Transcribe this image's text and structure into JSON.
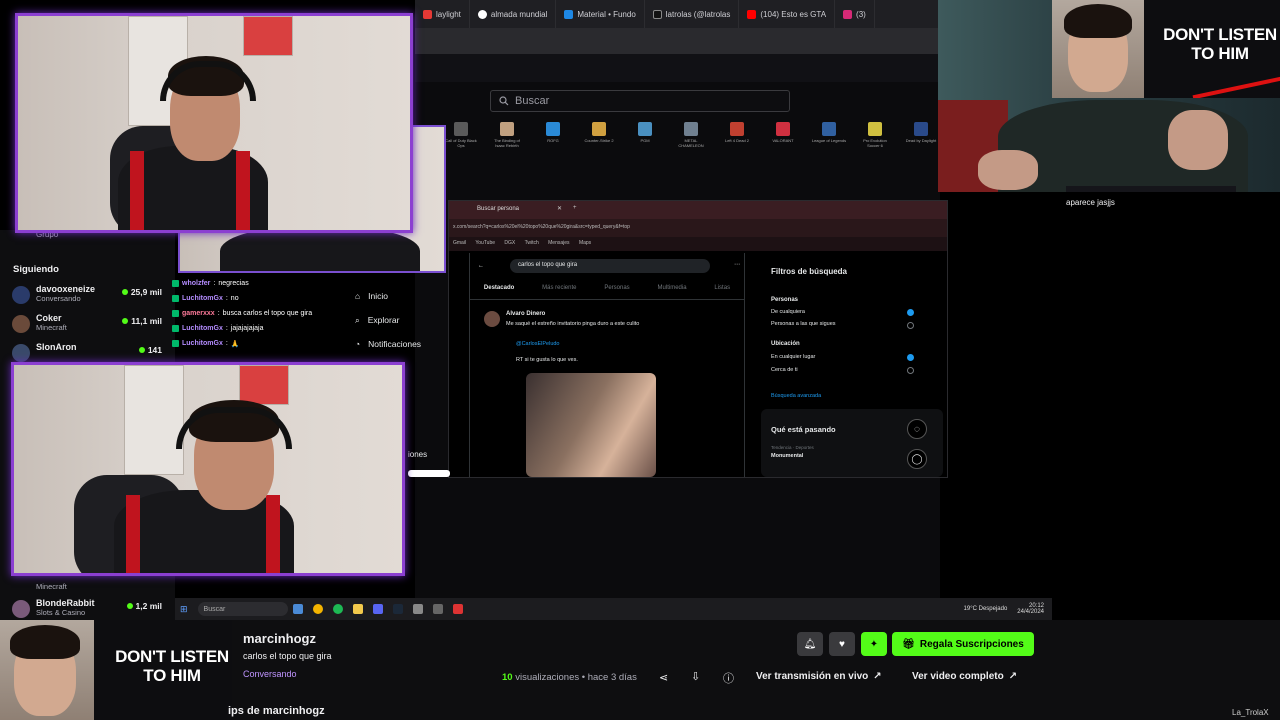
{
  "browser": {
    "tabs": [
      "laylight",
      "almada mundial",
      "Material • Fundo",
      "latrolas (@latrolas",
      "(104) Esto es GTA",
      "(3)"
    ]
  },
  "desktop": {
    "search_placeholder": "Buscar",
    "games": [
      "Call of Duty Black Ops",
      "The Binding of Isaac Rebirth",
      "ROFG",
      "Counter-Strike 2",
      "PGM",
      "METAL CHAMELEON",
      "Left 4 Dead 2",
      "VALORANT",
      "League of Legends",
      "Pro Evolution Soccer 6",
      "Dead by Daylight",
      "Pirates"
    ]
  },
  "inner_window": {
    "tab": "Buscar persona",
    "address": "x.com/search?q=carlos%20el%20topo%20que%20gira&src=typed_query&f=top",
    "bookmarks": [
      "Gmail",
      "YouTube",
      "DGX",
      "Twitch",
      "Mensajes",
      "Maps"
    ],
    "search_query": "carlos el topo que gira",
    "tabs": [
      "Destacado",
      "Más reciente",
      "Personas",
      "Multimedia",
      "Listas"
    ],
    "tweet_author": "Alvaro Dinero",
    "tweet_text": "Me saqué el estreño invitatorio pinga duro a este culito",
    "tweet_mention": "@CarlosElPeludo",
    "tweet_reply": "RT si te gusta lo que ves.",
    "filters_title": "Filtros de búsqueda",
    "people_label": "Personas",
    "people_opt1": "De cualquiera",
    "people_opt2": "Personas a las que sigues",
    "location_label": "Ubicación",
    "loc_opt1": "En cualquier lugar",
    "loc_opt2": "Cerca de ti",
    "advanced": "Búsqueda avanzada",
    "trending_title": "Qué está pasando",
    "trend_cat": "Tendencia · Deportes",
    "trend_name": "Monumental"
  },
  "sidebar": {
    "section_top": "Grupo",
    "following_label": "Siguiendo",
    "items": [
      {
        "name": "davooxeneize",
        "sub": "Conversando",
        "count": "25,9 mil"
      },
      {
        "name": "Coker",
        "sub": "Minecraft",
        "count": "11,1 mil"
      },
      {
        "name": "SlonAron",
        "sub": "",
        "count": "141"
      }
    ],
    "bottom_items": [
      {
        "name": "",
        "sub": "Minecraft",
        "count": ""
      },
      {
        "name": "BlondeRabbit",
        "sub": "Slots & Casino",
        "count": "1,2 mil"
      }
    ]
  },
  "chat": [
    {
      "user": "wholzfer",
      "msg": "negrecias"
    },
    {
      "user": "LuchitomGx",
      "msg": "no"
    },
    {
      "user": "gamerxxx",
      "msg": "busca carlos el topo que gira"
    },
    {
      "user": "LuchitomGx",
      "msg": "jajajajajaja"
    },
    {
      "user": "LuchitomGx",
      "msg": "🙏"
    }
  ],
  "x_nav": [
    "Inicio",
    "Explorar",
    "Notificaciones"
  ],
  "x_nav_partial": "iones",
  "overlay": {
    "dont_line1": "DON'T LISTEN",
    "dont_line2": "TO HIM"
  },
  "right_chat": {
    "line": "aparece jasjjs"
  },
  "taskbar": {
    "search": "Buscar",
    "weather": "19°C Despejado",
    "time": "20:12",
    "date": "24/4/2024"
  },
  "stream": {
    "streamer": "marcinhogz",
    "title": "carlos el topo que gira",
    "category": "Conversando",
    "views_count": "10",
    "views_text": "visualizaciones • hace 3 días",
    "sub_button": "Regala Suscripciones",
    "live_button": "Ver transmisión en vivo",
    "full_button": "Ver video completo",
    "clips_label": "ips de marcinhogz"
  },
  "watermark": "La_TrolaX"
}
